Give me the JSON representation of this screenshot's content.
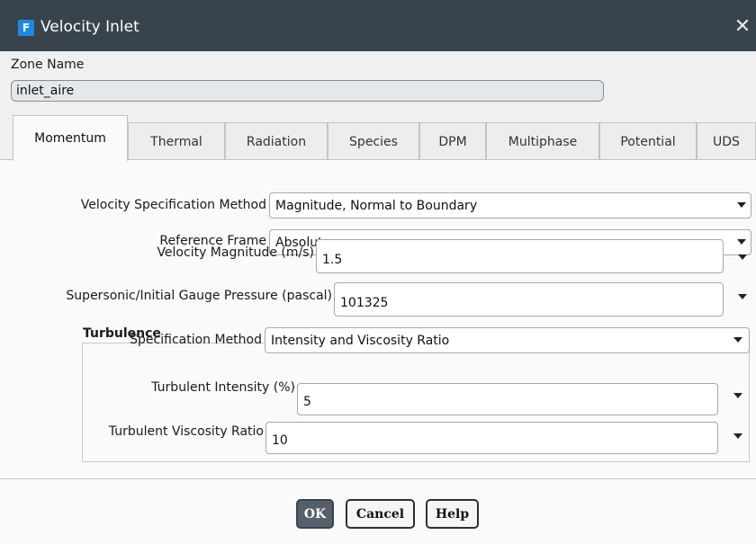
{
  "window": {
    "app_icon_letter": "F",
    "title": "Velocity Inlet",
    "close_glyph": "✕"
  },
  "zone": {
    "label": "Zone Name",
    "value": "inlet_aire"
  },
  "tabs": [
    {
      "label": "Momentum",
      "active": true
    },
    {
      "label": "Thermal"
    },
    {
      "label": "Radiation"
    },
    {
      "label": "Species"
    },
    {
      "label": "DPM"
    },
    {
      "label": "Multiphase"
    },
    {
      "label": "Potential"
    },
    {
      "label": "UDS"
    }
  ],
  "momentum": {
    "velocity_spec_label": "Velocity Specification Method",
    "velocity_spec_value": "Magnitude, Normal to Boundary",
    "reference_frame_label": "Reference Frame",
    "reference_frame_value": "Absolute",
    "velocity_magnitude_label": "Velocity Magnitude (m/s)",
    "velocity_magnitude_value": "1.5",
    "gauge_pressure_label": "Supersonic/Initial Gauge Pressure (pascal)",
    "gauge_pressure_value": "101325"
  },
  "turbulence": {
    "title": "Turbulence",
    "spec_method_label": "Specification Method",
    "spec_method_value": "Intensity and Viscosity Ratio",
    "intensity_label": "Turbulent Intensity (%)",
    "intensity_value": "5",
    "viscosity_ratio_label": "Turbulent Viscosity Ratio",
    "viscosity_ratio_value": "10"
  },
  "buttons": {
    "ok": "OK",
    "cancel": "Cancel",
    "help": "Help"
  },
  "colors": {
    "titlebar": "#38434c",
    "app_icon": "#1e88e5",
    "zone_field": "#e4e7ec",
    "ok_button": "#55606a"
  },
  "icons": [
    "app-icon",
    "close-icon",
    "chevron-down-icon"
  ]
}
